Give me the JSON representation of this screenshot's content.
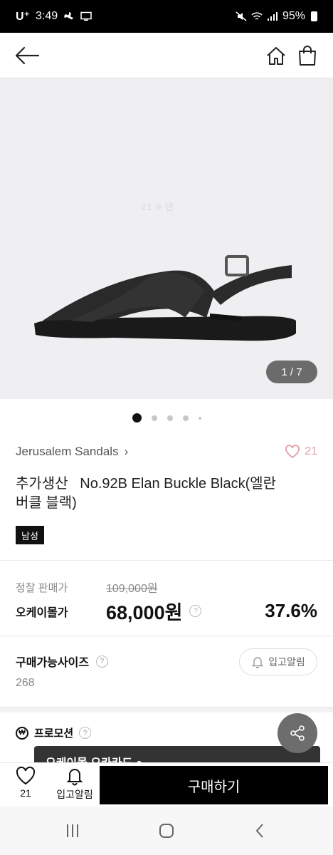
{
  "status_bar": {
    "carrier": "U⁺",
    "time": "3:49",
    "battery": "95%"
  },
  "product": {
    "image_counter": "1 / 7",
    "watermark": "21 9 년",
    "brand": "Jerusalem Sandals",
    "likes": "21",
    "title": "추가생산   No.92B Elan Buckle Black(엘란\n버클 블랙)",
    "tag": "남성"
  },
  "pricing": {
    "regular_label": "정찰 판매가",
    "regular_price": "109,000원",
    "ok_label": "오케이몰가",
    "ok_price": "68,000원",
    "discount": "37.6%"
  },
  "sizes": {
    "title": "구매가능사이즈",
    "value": "268",
    "restock_button": "입고알림"
  },
  "promotion": {
    "title": "프로모션",
    "badge": "₩",
    "card_text": "오케이몰 오카카드 ●"
  },
  "bottom_bar": {
    "like_count": "21",
    "restock_label": "입고알림",
    "buy_label": "구매하기"
  },
  "icons": [
    "back-arrow-icon",
    "home-icon",
    "shopping-bag-icon",
    "heart-icon",
    "chevron-right-icon",
    "question-icon",
    "bell-icon",
    "share-icon",
    "won-coin-icon"
  ],
  "colors": {
    "buy_button": "#000000",
    "heart_accent": "#e0a0a8",
    "page_indicator": "#6b6b6b"
  }
}
